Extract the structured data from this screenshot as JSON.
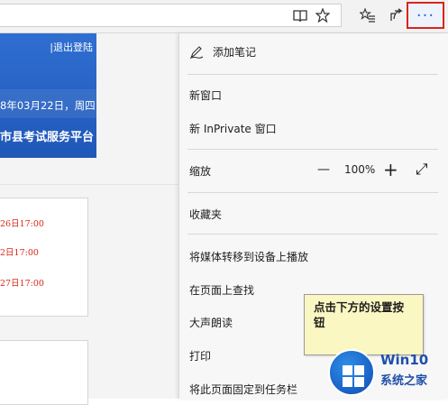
{
  "toolbar": {
    "icons": [
      "reading-view-icon",
      "favorite-star-icon",
      "favorites-hub-icon",
      "share-icon",
      "more-icon"
    ],
    "more_glyph": "···",
    "highlight_color": "#d9251c"
  },
  "page": {
    "logout": "|退出登陆",
    "date": "8年03月22日，周四",
    "platform": "市县考试服务平台",
    "notices": [
      "26日17:00",
      "2日17:00",
      "27日17:00"
    ],
    "brand_color": "#2f6fd1",
    "notice_color": "#d8281c"
  },
  "menu": {
    "add_notes": "添加笔记",
    "new_window": "新窗口",
    "new_inprivate": "新 InPrivate 窗口",
    "zoom": {
      "label": "缩放",
      "minus": "—",
      "value": "100%",
      "plus": "+",
      "fullscreen": "⤢"
    },
    "favorites": "收藏夹",
    "cast": "将媒体转移到设备上播放",
    "find": "在页面上查找",
    "read_aloud": "大声朗读",
    "print": "打印",
    "pin_taskbar": "将此页面固定到任务栏"
  },
  "callout": {
    "text": "点击下方的设置按钮",
    "bg_color": "#fbf7c2"
  },
  "watermark": {
    "title": "Win10",
    "subtitle": "系统之家"
  }
}
